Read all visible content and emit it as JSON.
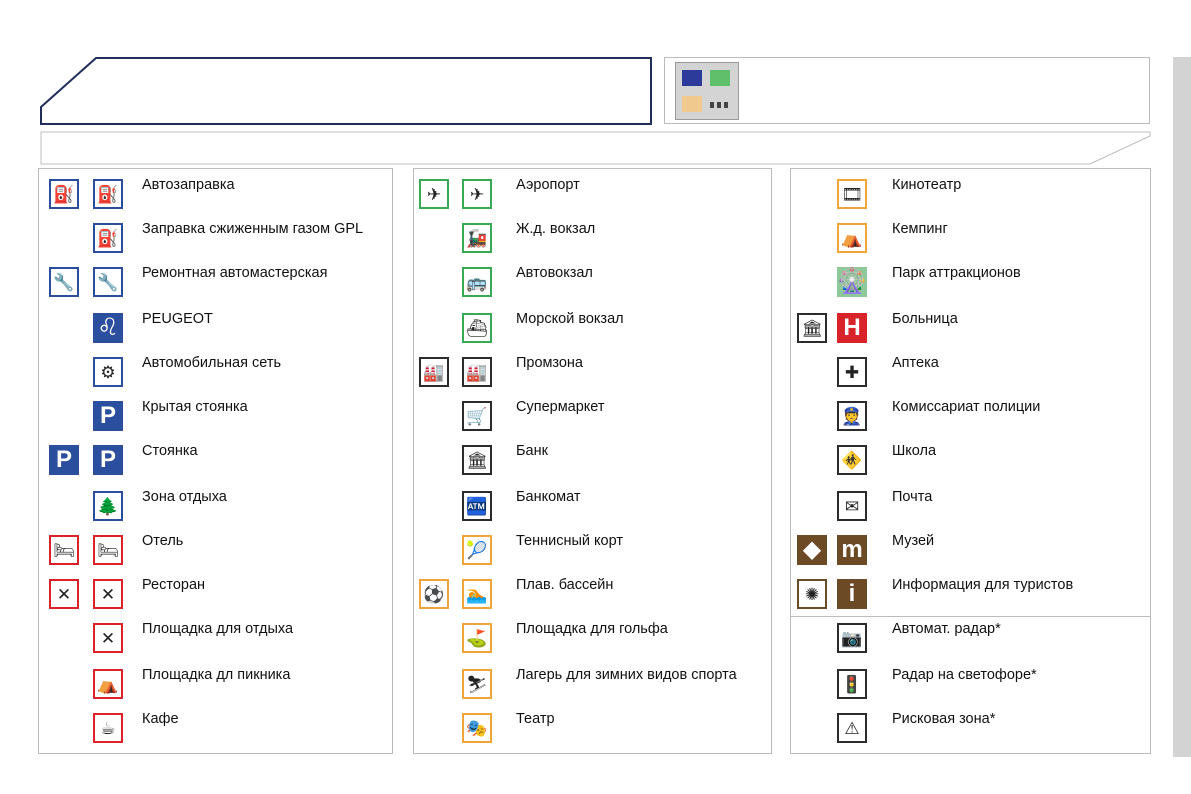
{
  "colors": {
    "blue": "#2c4e9e",
    "navy": "#1f2e5a",
    "green": "#3aa956",
    "orange": "#f0a43a",
    "red": "#d9232a",
    "dark": "#2b2b2b",
    "brown": "#6b4a25",
    "greenfill": "#8fc89a"
  },
  "columns": [
    {
      "name": "col1",
      "items": [
        {
          "label": "Автозаправка",
          "icons": [
            {
              "n": "fuel-station-icon",
              "g": "⛽",
              "c": "blue"
            },
            {
              "n": "fuel-station-icon",
              "g": "⛽",
              "c": "blue"
            }
          ]
        },
        {
          "label": "Заправка сжиженным газом GPL",
          "icons": [
            {
              "n": "lpg-station-icon",
              "g": "⛽",
              "c": "blue"
            }
          ]
        },
        {
          "label": "Ремонтная автомастерская",
          "icons": [
            {
              "n": "garage-icon",
              "g": "🔧",
              "c": "blue"
            },
            {
              "n": "garage-icon",
              "g": "🔧",
              "c": "blue"
            }
          ]
        },
        {
          "label": "PEUGEOT",
          "icons": [
            {
              "n": "peugeot-lion-icon",
              "g": "♌",
              "c": "blue",
              "solid": true
            }
          ]
        },
        {
          "label": "Автомобильная сеть",
          "icons": [
            {
              "n": "car-network-icon",
              "g": "⚙",
              "c": "blue"
            }
          ]
        },
        {
          "label": "Крытая стоянка",
          "icons": [
            {
              "n": "covered-parking-icon",
              "g": "P",
              "c": "blue",
              "solid": true
            }
          ]
        },
        {
          "label": "Стоянка",
          "icons": [
            {
              "n": "parking-icon",
              "g": "P",
              "c": "blue",
              "solid": true
            },
            {
              "n": "parking-icon",
              "g": "P",
              "c": "blue",
              "solid": true
            }
          ]
        },
        {
          "label": "Зона отдыха",
          "icons": [
            {
              "n": "rest-area-icon",
              "g": "🌲",
              "c": "blue"
            }
          ]
        },
        {
          "label": "Отель",
          "icons": [
            {
              "n": "hotel-bed-icon",
              "g": "🛏",
              "c": "red"
            },
            {
              "n": "hotel-bed-icon",
              "g": "🛏",
              "c": "red"
            }
          ]
        },
        {
          "label": "Ресторан",
          "icons": [
            {
              "n": "restaurant-cutlery-icon",
              "g": "✕",
              "c": "red"
            },
            {
              "n": "restaurant-cutlery-icon",
              "g": "✕",
              "c": "red"
            }
          ]
        },
        {
          "label": "Площадка для отдыха",
          "icons": [
            {
              "n": "rest-stop-icon",
              "g": "✕",
              "c": "red"
            }
          ]
        },
        {
          "label": "Площадка дл пикника",
          "icons": [
            {
              "n": "picnic-area-icon",
              "g": "⛺",
              "c": "red"
            }
          ]
        },
        {
          "label": "Кафе",
          "icons": [
            {
              "n": "cafe-cup-icon",
              "g": "☕",
              "c": "red"
            }
          ]
        }
      ]
    },
    {
      "name": "col2",
      "items": [
        {
          "label": "Аэропорт",
          "icons": [
            {
              "n": "transport-hub-icon",
              "g": "✈",
              "c": "green"
            },
            {
              "n": "airport-plane-icon",
              "g": "✈",
              "c": "green"
            }
          ]
        },
        {
          "label": "Ж.д. вокзал",
          "icons": [
            {
              "n": "train-station-icon",
              "g": "🚂",
              "c": "green"
            }
          ]
        },
        {
          "label": "Автовокзал",
          "icons": [
            {
              "n": "bus-station-icon",
              "g": "🚌",
              "c": "green"
            }
          ]
        },
        {
          "label": "Морской вокзал",
          "icons": [
            {
              "n": "ferry-terminal-icon",
              "g": "⛴",
              "c": "green"
            }
          ]
        },
        {
          "label": "Промзона",
          "icons": [
            {
              "n": "industrial-zone-icon",
              "g": "🏭",
              "c": "dark"
            },
            {
              "n": "industrial-zone-icon",
              "g": "🏭",
              "c": "dark"
            }
          ]
        },
        {
          "label": "Супермаркет",
          "icons": [
            {
              "n": "shopping-cart-icon",
              "g": "🛒",
              "c": "dark"
            }
          ]
        },
        {
          "label": "Банк",
          "icons": [
            {
              "n": "bank-icon",
              "g": "🏛",
              "c": "dark"
            }
          ]
        },
        {
          "label": "Банкомат",
          "icons": [
            {
              "n": "atm-icon",
              "g": "🏧",
              "c": "dark"
            }
          ]
        },
        {
          "label": "Теннисный корт",
          "icons": [
            {
              "n": "tennis-icon",
              "g": "🎾",
              "c": "orange"
            }
          ]
        },
        {
          "label": "Плав. бассейн",
          "icons": [
            {
              "n": "sport-activities-icon",
              "g": "⚽",
              "c": "orange"
            },
            {
              "n": "swimming-pool-icon",
              "g": "🏊",
              "c": "orange"
            }
          ]
        },
        {
          "label": "Площадка для гольфа",
          "icons": [
            {
              "n": "golf-icon",
              "g": "⛳",
              "c": "orange"
            }
          ]
        },
        {
          "label": "Лагерь для зимних видов спорта",
          "icons": [
            {
              "n": "ski-icon",
              "g": "⛷",
              "c": "orange"
            }
          ]
        },
        {
          "label": "Театр",
          "icons": [
            {
              "n": "theatre-icon",
              "g": "🎭",
              "c": "orange"
            }
          ]
        }
      ]
    },
    {
      "name": "col3",
      "items": [
        {
          "label": "Кинотеатр",
          "icons": [
            {
              "n": "cinema-film-icon",
              "g": "🎞",
              "c": "orange"
            }
          ]
        },
        {
          "label": "Кемпинг",
          "icons": [
            {
              "n": "camping-icon",
              "g": "⛺",
              "c": "orange"
            }
          ]
        },
        {
          "label": "Парк аттракционов",
          "icons": [
            {
              "n": "amusement-park-icon",
              "g": "🎡",
              "c": "greenfill",
              "solid": true
            }
          ]
        },
        {
          "label": "Больница",
          "icons": [
            {
              "n": "monument-icon",
              "g": "🏛",
              "c": "dark"
            },
            {
              "n": "hospital-icon",
              "g": "H",
              "c": "red",
              "solid": true
            }
          ]
        },
        {
          "label": "Аптека",
          "icons": [
            {
              "n": "pharmacy-cross-icon",
              "g": "✚",
              "c": "dark"
            }
          ]
        },
        {
          "label": "Комиссариат полиции",
          "icons": [
            {
              "n": "police-station-icon",
              "g": "👮",
              "c": "dark"
            }
          ]
        },
        {
          "label": "Школа",
          "icons": [
            {
              "n": "school-children-icon",
              "g": "🚸",
              "c": "dark"
            }
          ]
        },
        {
          "label": "Почта",
          "icons": [
            {
              "n": "post-envelope-icon",
              "g": "✉",
              "c": "dark"
            }
          ]
        },
        {
          "label": "Музей",
          "icons": [
            {
              "n": "landmark-icon",
              "g": "◆",
              "c": "brown",
              "solid": true
            },
            {
              "n": "museum-icon",
              "g": "m",
              "c": "brown",
              "solid": true
            }
          ]
        },
        {
          "label": "Информация для туристов",
          "icons": [
            {
              "n": "viewpoint-icon",
              "g": "✺",
              "c": "brown"
            },
            {
              "n": "tourist-info-icon",
              "g": "i",
              "c": "brown",
              "solid": true
            }
          ]
        },
        {
          "label": "Автомат. радар*",
          "icons": [
            {
              "n": "speed-camera-icon",
              "g": "📷",
              "c": "dark"
            }
          ]
        },
        {
          "label": "Радар на светофоре*",
          "icons": [
            {
              "n": "traffic-light-camera-icon",
              "g": "🚦",
              "c": "dark"
            }
          ]
        },
        {
          "label": "Рисковая зона*",
          "icons": [
            {
              "n": "risk-zone-warning-icon",
              "g": "⚠",
              "c": "dark"
            }
          ]
        }
      ]
    }
  ]
}
